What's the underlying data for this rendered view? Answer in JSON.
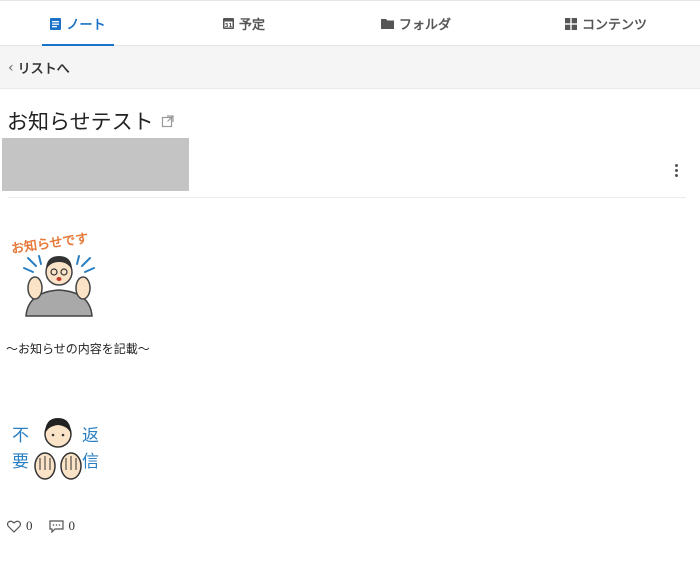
{
  "tabs": [
    {
      "label": "ノート",
      "icon": "note-icon",
      "active": true
    },
    {
      "label": "予定",
      "icon": "calendar-icon",
      "active": false
    },
    {
      "label": "フォルダ",
      "icon": "folder-icon",
      "active": false
    },
    {
      "label": "コンテンツ",
      "icon": "grid-icon",
      "active": false
    }
  ],
  "back": {
    "label": "リストへ",
    "icon": "chevron-left-icon"
  },
  "post": {
    "title": "お知らせテスト",
    "title_icon": "external-link-icon",
    "menu_icon": "kebab-menu-icon",
    "illustration_top_text": "お知らせです",
    "body": "〜お知らせの内容を記載〜",
    "illustration_bottom_text": [
      "不",
      "要",
      "返",
      "信"
    ]
  },
  "reactions": {
    "likes": "0",
    "comments": "0",
    "like_icon": "heart-icon",
    "comment_icon": "comment-icon"
  },
  "colors": {
    "accent": "#1a73c8",
    "illustration_orange": "#e67a3c",
    "illustration_blue": "#2a7fc2"
  }
}
